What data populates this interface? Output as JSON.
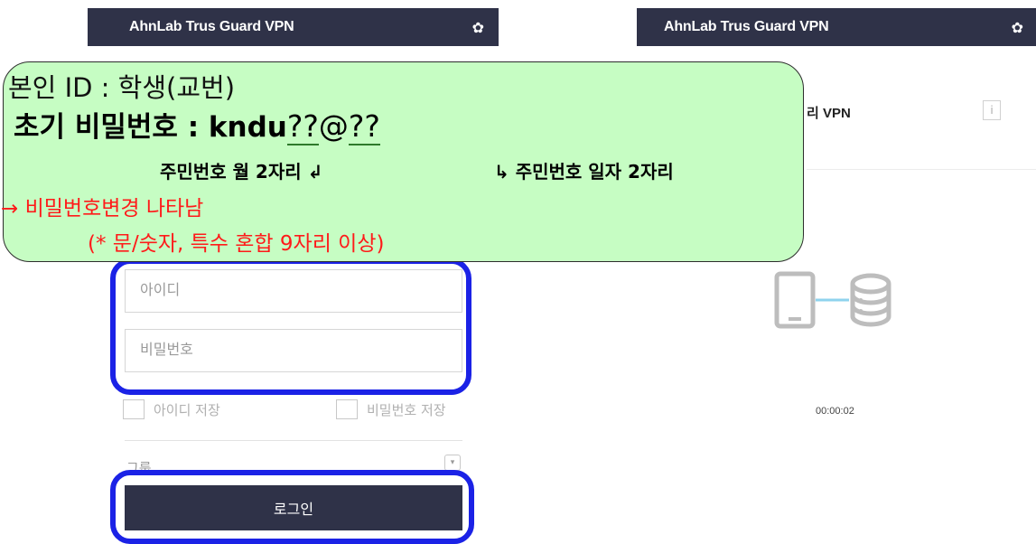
{
  "left_app": {
    "title": "AhnLab Trus Guard VPN",
    "id_placeholder": "아이디",
    "pw_placeholder": "비밀번호",
    "save_id_label": "아이디 저장",
    "save_pw_label": "비밀번호 저장",
    "group_label": "그룹",
    "login_label": "로그인"
  },
  "right_app": {
    "title": "AhnLab Trus Guard VPN",
    "vpn_label": "리 VPN",
    "info_icon": "i",
    "timer": "00:00:02"
  },
  "annotation": {
    "line1": "본인 ID : 학생(교번)",
    "line2_prefix": "초기 비밀번호 : kndu",
    "line2_q1": "??",
    "line2_at": "@",
    "line2_q2": "??",
    "line3_left": "주민번호 월 2자리 ↲",
    "line3_right": "↳ 주민번호 일자 2자리",
    "line4": "→  비밀번호변경 나타남",
    "line5": "(* 문/숫자, 특수 혼합 9자리 이상)"
  },
  "colors": {
    "header": "#2f3248",
    "highlight": "#1b22e6",
    "bubble": "#c6fdc3",
    "note_red": "#ff1a1a",
    "connector": "#8fd3ee"
  },
  "icons": [
    "gear-icon",
    "info-icon",
    "phone-icon",
    "database-icon",
    "dropdown-arrow-icon"
  ]
}
